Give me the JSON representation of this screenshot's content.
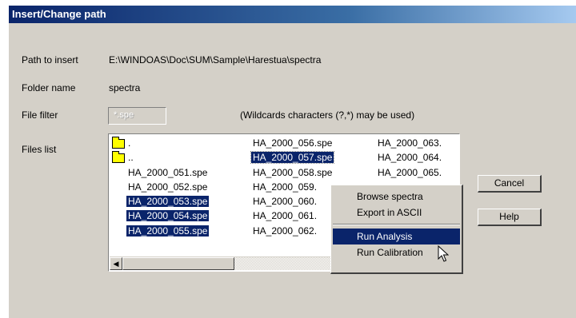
{
  "dialog": {
    "title": "Insert/Change path",
    "path_label": "Path to insert",
    "path_value": "E:\\WINDOAS\\Doc\\SUM\\Sample\\Harestua\\spectra",
    "folder_label": "Folder name",
    "folder_value": "spectra",
    "filter_label": "File filter",
    "filter_value": "*.spe",
    "filter_hint": "(Wildcards characters (?,*) may be used)",
    "files_label": "Files list"
  },
  "files": {
    "col1": [
      ".",
      "..",
      "HA_2000_051.spe",
      "HA_2000_052.spe",
      "HA_2000_053.spe",
      "HA_2000_054.spe",
      "HA_2000_055.spe"
    ],
    "col2": [
      "HA_2000_056.spe",
      "HA_2000_057.spe",
      "HA_2000_058.spe",
      "HA_2000_059.",
      "HA_2000_060.",
      "HA_2000_061.",
      "HA_2000_062."
    ],
    "col3": [
      "HA_2000_063.",
      "HA_2000_064.",
      "HA_2000_065."
    ],
    "selected": [
      "HA_2000_053.spe",
      "HA_2000_054.spe",
      "HA_2000_055.spe",
      "HA_2000_057.spe"
    ]
  },
  "buttons": {
    "cancel": "Cancel",
    "help": "Help"
  },
  "context_menu": {
    "items": [
      "Browse spectra",
      "Export in ASCII",
      "Run Analysis",
      "Run Calibration"
    ],
    "highlighted": "Run Analysis"
  },
  "colors": {
    "selection": "#0a246a",
    "dialog_bg": "#d4d0c8",
    "folder_icon": "#ffff00"
  }
}
